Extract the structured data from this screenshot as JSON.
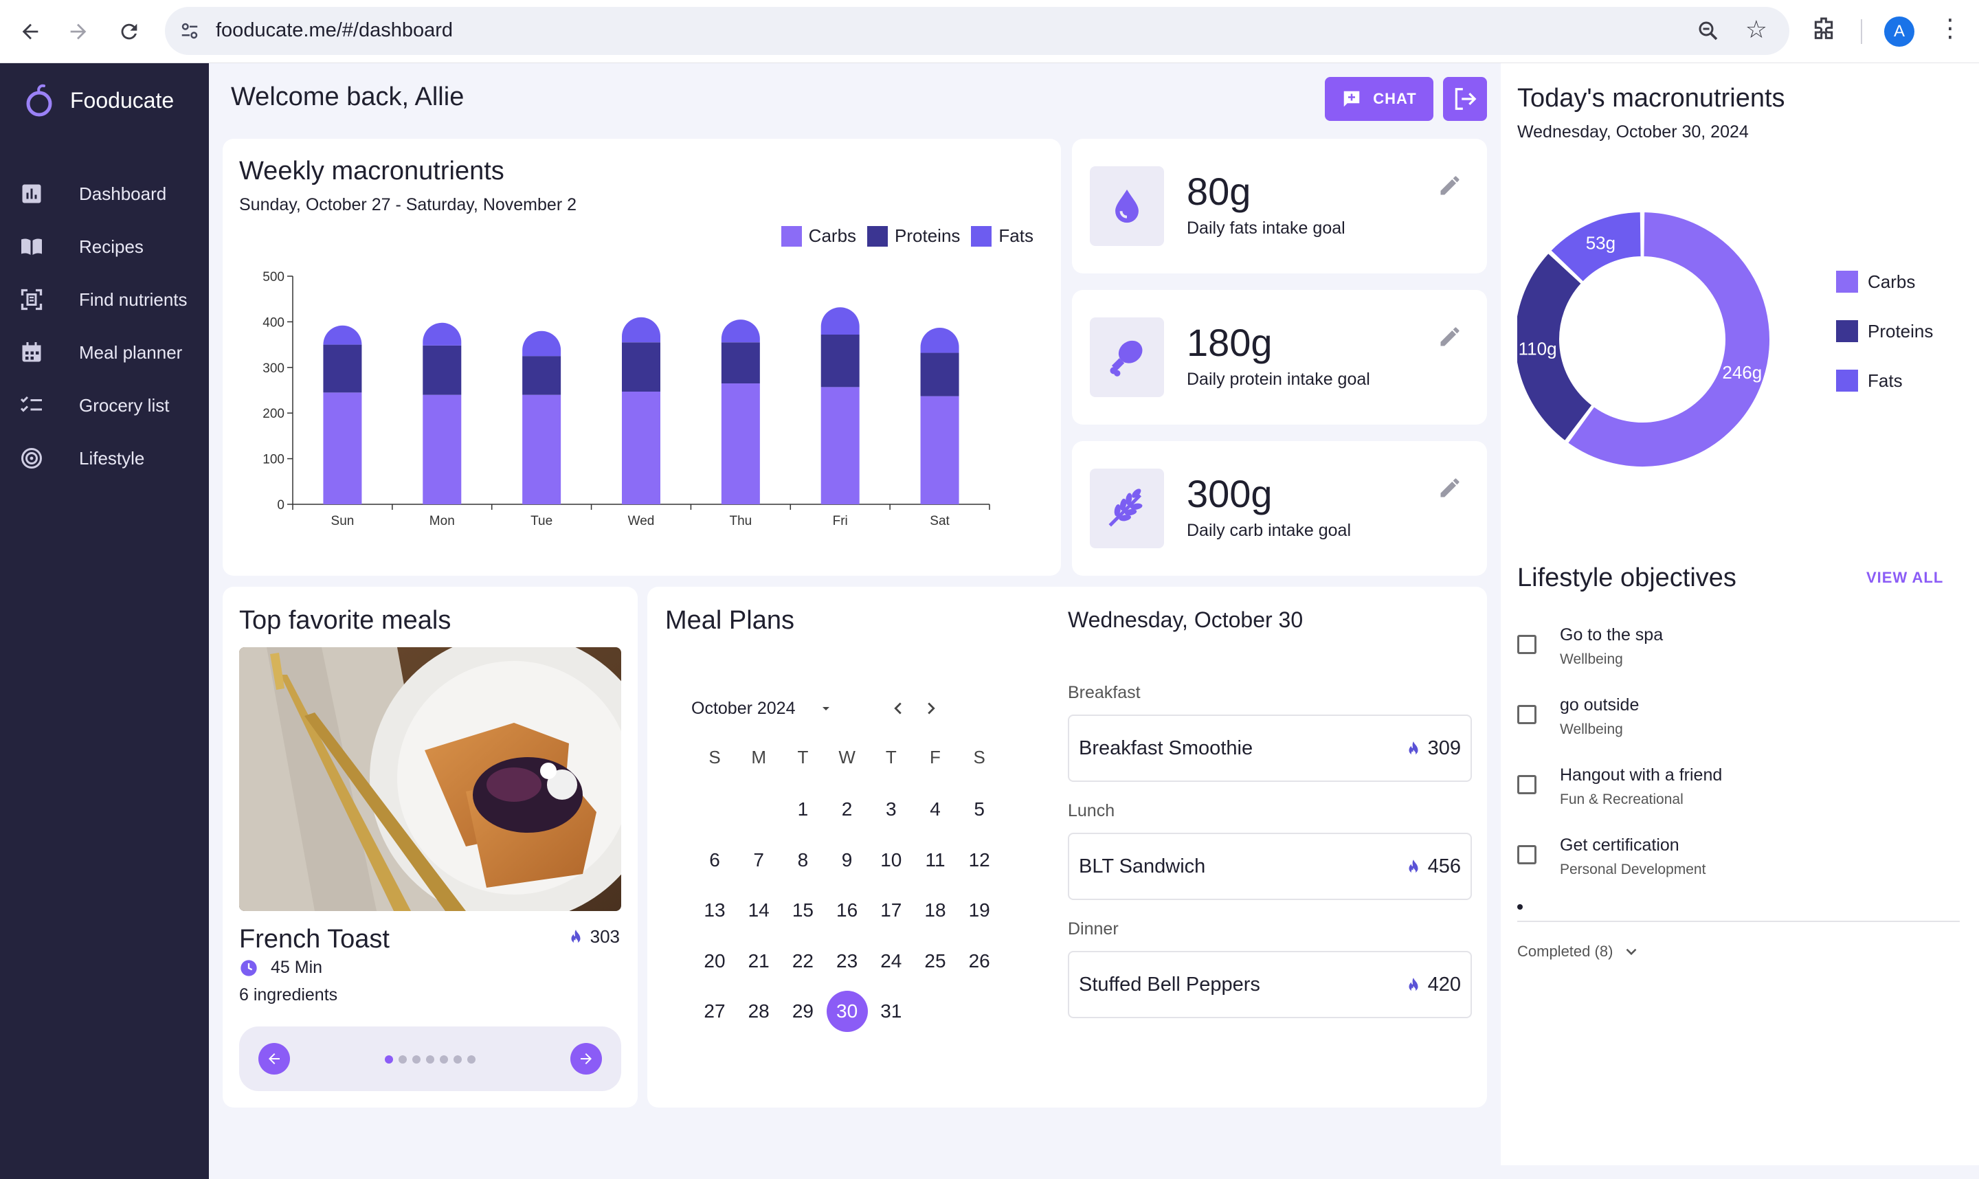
{
  "browser": {
    "url": "fooducate.me/#/dashboard",
    "avatar_letter": "A"
  },
  "app": {
    "brand": "Fooducate",
    "accent_color": "#8b5cf6",
    "sidebar_color": "#24233d"
  },
  "sidebar": {
    "items": [
      {
        "label": "Dashboard",
        "icon": "bar-chart-icon"
      },
      {
        "label": "Recipes",
        "icon": "book-icon"
      },
      {
        "label": "Find nutrients",
        "icon": "scan-icon"
      },
      {
        "label": "Meal planner",
        "icon": "calendar-icon"
      },
      {
        "label": "Grocery list",
        "icon": "checklist-icon"
      },
      {
        "label": "Lifestyle",
        "icon": "target-icon"
      }
    ]
  },
  "header": {
    "welcome": "Welcome back, Allie",
    "chat_label": "CHAT"
  },
  "weekly": {
    "title": "Weekly macronutrients",
    "range": "Sunday, October 27 - Saturday, November 2"
  },
  "chart_data": {
    "type": "bar",
    "stacked": true,
    "categories": [
      "Sun",
      "Mon",
      "Tue",
      "Wed",
      "Thu",
      "Fri",
      "Sat"
    ],
    "series": [
      {
        "name": "Carbs",
        "color": "#8b6cf6",
        "values": [
          245,
          240,
          240,
          247,
          265,
          257,
          237
        ]
      },
      {
        "name": "Proteins",
        "color": "#3b3592",
        "values": [
          105,
          108,
          85,
          108,
          90,
          115,
          95
        ]
      },
      {
        "name": "Fats",
        "color": "#6d5cf0",
        "values": [
          42,
          50,
          55,
          55,
          50,
          60,
          55
        ]
      }
    ],
    "ylim": [
      0,
      500
    ],
    "yticks": [
      0,
      100,
      200,
      300,
      400,
      500
    ],
    "legend": "top-right",
    "grid": false
  },
  "goals": [
    {
      "value": "80g",
      "label": "Daily fats intake goal",
      "icon": "water-drop-icon"
    },
    {
      "value": "180g",
      "label": "Daily protein intake goal",
      "icon": "drumstick-icon"
    },
    {
      "value": "300g",
      "label": "Daily carb intake goal",
      "icon": "wheat-icon"
    }
  ],
  "today": {
    "title": "Today's macronutrients",
    "date": "Wednesday, October 30, 2024",
    "chart": {
      "type": "pie",
      "donut": true,
      "slices": [
        {
          "name": "Carbs",
          "value": 246,
          "label": "246g",
          "color": "#8b6cf6"
        },
        {
          "name": "Proteins",
          "value": 110,
          "label": "110g",
          "color": "#3b3592"
        },
        {
          "name": "Fats",
          "value": 53,
          "label": "53g",
          "color": "#6d5cf0"
        }
      ],
      "legend": "right"
    }
  },
  "lifestyle": {
    "title": "Lifestyle objectives",
    "view_all": "VIEW ALL",
    "objectives": [
      {
        "title": "Go to the spa",
        "category": "Wellbeing"
      },
      {
        "title": "go outside",
        "category": "Wellbeing"
      },
      {
        "title": "Hangout with a friend",
        "category": "Fun & Recreational"
      },
      {
        "title": "Get certification",
        "category": "Personal Development"
      }
    ],
    "completed": "Completed (8)"
  },
  "favorites": {
    "title": "Top favorite meals",
    "meal_name": "French Toast",
    "calories": "303",
    "time": "45 Min",
    "ingredients": "6 ingredients",
    "dots": 7,
    "active_dot": 0
  },
  "plans": {
    "title": "Meal Plans",
    "month": "October 2024",
    "weekdays": [
      "S",
      "M",
      "T",
      "W",
      "T",
      "F",
      "S"
    ],
    "first_weekday": 2,
    "days_in_month": 31,
    "selected_day": 30,
    "day_title": "Wednesday, October 30",
    "meals": [
      {
        "type": "Breakfast",
        "name": "Breakfast Smoothie",
        "calories": "309"
      },
      {
        "type": "Lunch",
        "name": "BLT Sandwich",
        "calories": "456"
      },
      {
        "type": "Dinner",
        "name": "Stuffed Bell Peppers",
        "calories": "420"
      }
    ]
  }
}
